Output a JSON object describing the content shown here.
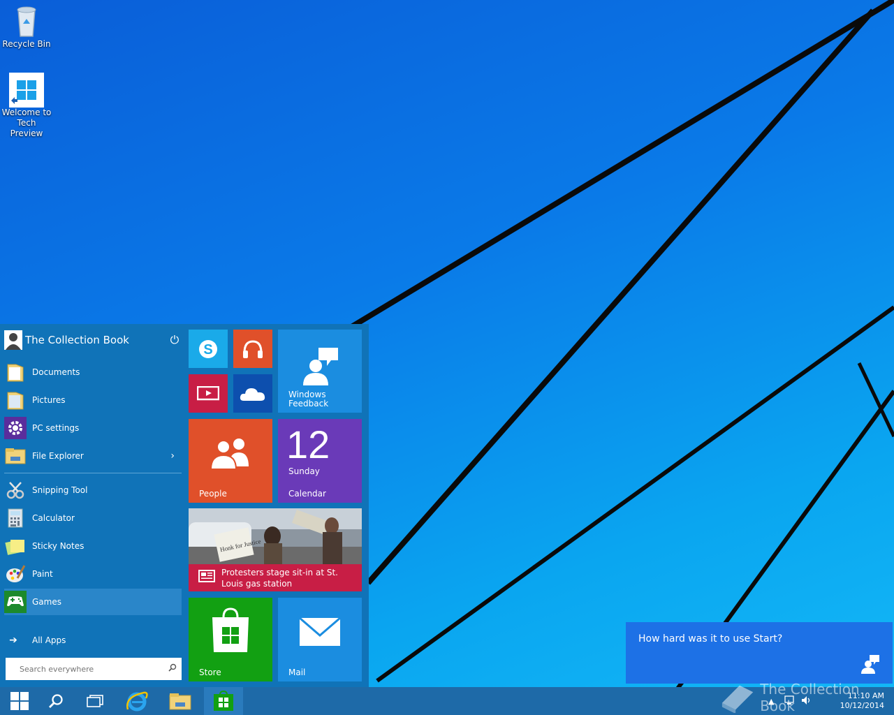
{
  "desktop": {
    "icons": [
      {
        "label_line1": "Recycle Bin",
        "label_line2": "",
        "icon": "recycle-bin-icon"
      },
      {
        "label_line1": "Welcome to",
        "label_line2": "Tech Preview",
        "icon": "windows-logo-icon"
      }
    ]
  },
  "start_menu": {
    "user_name": "The Collection Book",
    "power_icon": "power-icon",
    "places": [
      {
        "label": "Documents",
        "icon": "folder-icon"
      },
      {
        "label": "Pictures",
        "icon": "folder-icon"
      },
      {
        "label": "PC settings",
        "icon": "gear-icon"
      },
      {
        "label": "File Explorer",
        "icon": "file-explorer-icon",
        "chevron": "›"
      }
    ],
    "apps": [
      {
        "label": "Snipping Tool",
        "icon": "scissors-icon"
      },
      {
        "label": "Calculator",
        "icon": "calculator-icon"
      },
      {
        "label": "Sticky Notes",
        "icon": "sticky-notes-icon"
      },
      {
        "label": "Paint",
        "icon": "palette-icon"
      },
      {
        "label": "Games",
        "icon": "gamepad-icon",
        "selected": true
      }
    ],
    "all_apps_label": "All Apps",
    "search_placeholder": "Search everywhere",
    "tiles": {
      "skype": {
        "icon": "skype-icon",
        "color": "#1aaae9"
      },
      "music": {
        "icon": "headphones-icon",
        "color": "#e0502a"
      },
      "video": {
        "icon": "video-icon",
        "color": "#c81e45"
      },
      "onedrive": {
        "icon": "cloud-icon",
        "color": "#0d4fae"
      },
      "feedback": {
        "label_line1": "Windows",
        "label_line2": "Feedback",
        "icon": "feedback-people-icon",
        "color": "#1b8de0"
      },
      "people": {
        "label": "People",
        "icon": "people-icon",
        "color": "#e0502a"
      },
      "calendar": {
        "day_number": "12",
        "day_name": "Sunday",
        "label": "Calendar",
        "color": "#6a3ab8"
      },
      "news": {
        "headline_line1": "Protesters stage sit-in at St.",
        "headline_line2": "Louis gas station",
        "sign_text": "Honk for Justice",
        "icon": "newspaper-icon",
        "color": "#c81e45"
      },
      "store": {
        "label": "Store",
        "icon": "store-bag-icon",
        "color": "#12a012"
      },
      "mail": {
        "label": "Mail",
        "icon": "mail-icon",
        "color": "#1b8de0"
      }
    }
  },
  "taskbar": {
    "buttons": [
      {
        "name": "start-button",
        "icon": "windows-logo-icon"
      },
      {
        "name": "search-button",
        "icon": "search-icon"
      },
      {
        "name": "task-view-button",
        "icon": "task-view-icon"
      },
      {
        "name": "internet-explorer-button",
        "icon": "internet-explorer-icon"
      },
      {
        "name": "file-explorer-button",
        "icon": "folder-icon"
      },
      {
        "name": "store-button",
        "icon": "store-icon"
      }
    ],
    "clock_time": "11:10 AM",
    "clock_date": "10/12/2014",
    "watermark": "The Collection Book"
  },
  "toast": {
    "question": "How hard was it to use Start?",
    "icon": "feedback-people-icon"
  }
}
